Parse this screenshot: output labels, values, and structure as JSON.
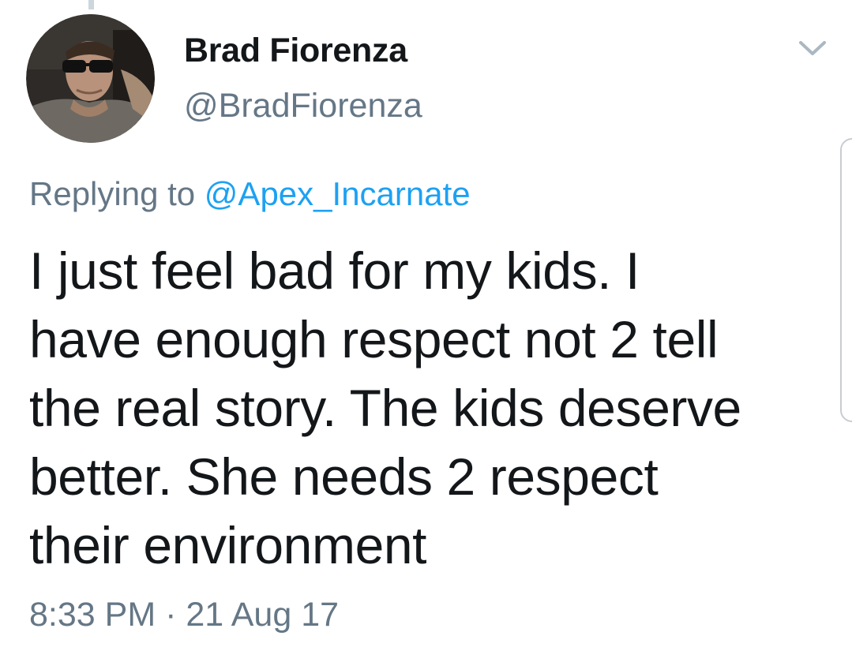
{
  "tweet": {
    "author": {
      "display_name": "Brad Fiorenza",
      "handle": "@BradFiorenza",
      "avatar_icon": "profile-photo"
    },
    "reply": {
      "prefix": "Replying to",
      "target": "@Apex_Incarnate"
    },
    "text_lines": [
      "I just feel bad for my kids. I",
      "have enough respect not 2 tell",
      "the real story. The kids deserve",
      "better. She needs 2 respect",
      "their environment"
    ],
    "timestamp": "8:33 PM · 21 Aug 17",
    "menu_icon": "chevron-down-icon"
  },
  "colors": {
    "text": "#14171a",
    "secondary": "#657786",
    "link": "#1da1f2",
    "background": "#ffffff"
  }
}
